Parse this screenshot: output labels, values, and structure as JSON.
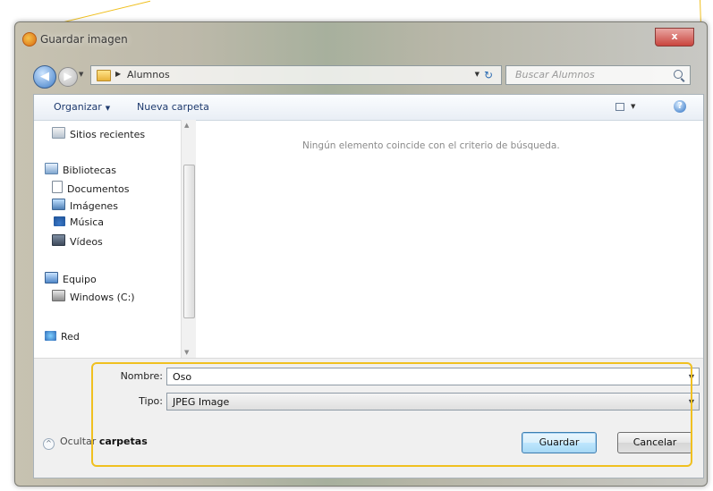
{
  "window": {
    "title": "Guardar imagen",
    "close_symbol": "x"
  },
  "toolbar": {
    "back_symbol": "◀",
    "forward_symbol": "▶",
    "address_path": "Alumnos",
    "search_placeholder": "Buscar Alumnos"
  },
  "command_bar": {
    "organize_label": "Organizar",
    "new_folder_label": "Nueva carpeta",
    "help_symbol": "?"
  },
  "nav": {
    "items": [
      {
        "label": "Sitios recientes",
        "icon": "recent-places-icon"
      },
      {
        "label": "Bibliotecas",
        "icon": "libraries-icon"
      },
      {
        "label": "Documentos",
        "icon": "documents-icon"
      },
      {
        "label": "Imágenes",
        "icon": "pictures-icon"
      },
      {
        "label": "Música",
        "icon": "music-icon"
      },
      {
        "label": "Vídeos",
        "icon": "videos-icon"
      },
      {
        "label": "Equipo",
        "icon": "computer-icon"
      },
      {
        "label": "Windows (C:)",
        "icon": "drive-icon"
      },
      {
        "label": "Red",
        "icon": "network-icon"
      }
    ]
  },
  "main": {
    "empty_message": "Ningún elemento coincide con el criterio de búsqueda."
  },
  "fields": {
    "name_label": "Nombre:",
    "name_value": "Oso",
    "type_label": "Tipo:",
    "type_value": "JPEG Image"
  },
  "footer": {
    "hide_prefix": "Ocultar",
    "hide_bold": "carpetas",
    "save_label": "Guardar",
    "cancel_label": "Cancelar"
  },
  "colors": {
    "callout": "#f0c020",
    "accent": "#3c7fb1"
  }
}
